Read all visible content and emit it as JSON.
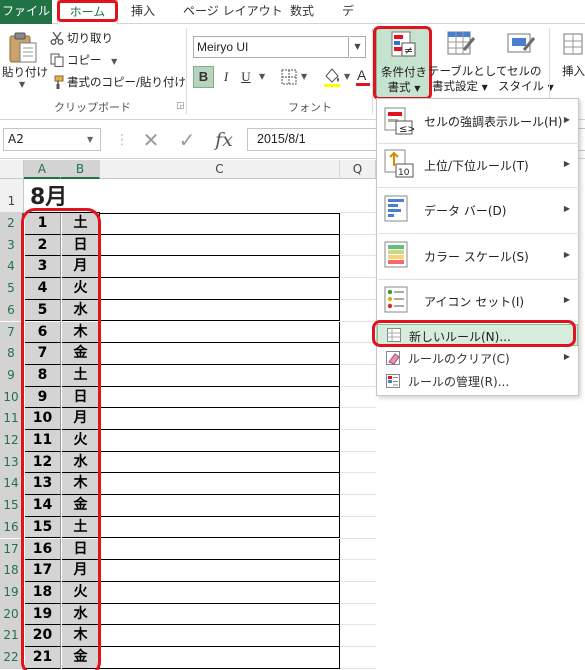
{
  "tabs": {
    "file": "ファイル",
    "home": "ホーム",
    "insert": "挿入",
    "page_layout": "ページ レイアウト",
    "formulas": "数式",
    "data": "デ"
  },
  "clipboard": {
    "paste": "貼り付け",
    "cut": "切り取り",
    "copy": "コピー",
    "format_painter": "書式のコピー/貼り付け",
    "group_label": "クリップボード"
  },
  "font": {
    "name": "Meiryo UI",
    "bold": "B",
    "italic": "I",
    "underline": "U",
    "group_label": "フォント"
  },
  "styles": {
    "conditional_formatting_line1": "条件付き",
    "conditional_formatting_line2": "書式",
    "format_as_table_line1": "テーブルとして",
    "format_as_table_line2": "書式設定",
    "cell_styles_line1": "セルの",
    "cell_styles_line2": "スタイル",
    "insert": "挿入"
  },
  "formula_bar": {
    "name_box": "A2",
    "cancel": "✕",
    "enter": "✓",
    "fx": "fx",
    "value": "2015/8/1"
  },
  "columns": [
    "A",
    "B",
    "C",
    "Q"
  ],
  "sheet": {
    "title": "8月",
    "row_numbers": [
      "1",
      "2",
      "3",
      "4",
      "5",
      "6",
      "7",
      "8",
      "9",
      "10",
      "11",
      "12",
      "13",
      "14",
      "15",
      "16",
      "17",
      "18",
      "19",
      "20",
      "21",
      "22"
    ],
    "rows": [
      {
        "day": "1",
        "weekday": "土"
      },
      {
        "day": "2",
        "weekday": "日"
      },
      {
        "day": "3",
        "weekday": "月"
      },
      {
        "day": "4",
        "weekday": "火"
      },
      {
        "day": "5",
        "weekday": "水"
      },
      {
        "day": "6",
        "weekday": "木"
      },
      {
        "day": "7",
        "weekday": "金"
      },
      {
        "day": "8",
        "weekday": "土"
      },
      {
        "day": "9",
        "weekday": "日"
      },
      {
        "day": "10",
        "weekday": "月"
      },
      {
        "day": "11",
        "weekday": "火"
      },
      {
        "day": "12",
        "weekday": "水"
      },
      {
        "day": "13",
        "weekday": "木"
      },
      {
        "day": "14",
        "weekday": "金"
      },
      {
        "day": "15",
        "weekday": "土"
      },
      {
        "day": "16",
        "weekday": "日"
      },
      {
        "day": "17",
        "weekday": "月"
      },
      {
        "day": "18",
        "weekday": "火"
      },
      {
        "day": "19",
        "weekday": "水"
      },
      {
        "day": "20",
        "weekday": "木"
      },
      {
        "day": "21",
        "weekday": "金"
      }
    ]
  },
  "cf_menu": {
    "highlight_rules": "セルの強調表示ルール(H)",
    "top_bottom_rules": "上位/下位ルール(T)",
    "data_bars": "データ バー(D)",
    "color_scales": "カラー スケール(S)",
    "icon_sets": "アイコン セット(I)",
    "new_rule": "新しいルール(N)...",
    "clear_rules": "ルールのクリア(C)",
    "manage_rules": "ルールの管理(R)...",
    "top_bottom_icon_text": "10"
  },
  "colors": {
    "excel_green": "#217346",
    "annotation_red": "#e0141e",
    "highlight": "#d6ecdc",
    "selected_cells": "#d4d4d4"
  }
}
